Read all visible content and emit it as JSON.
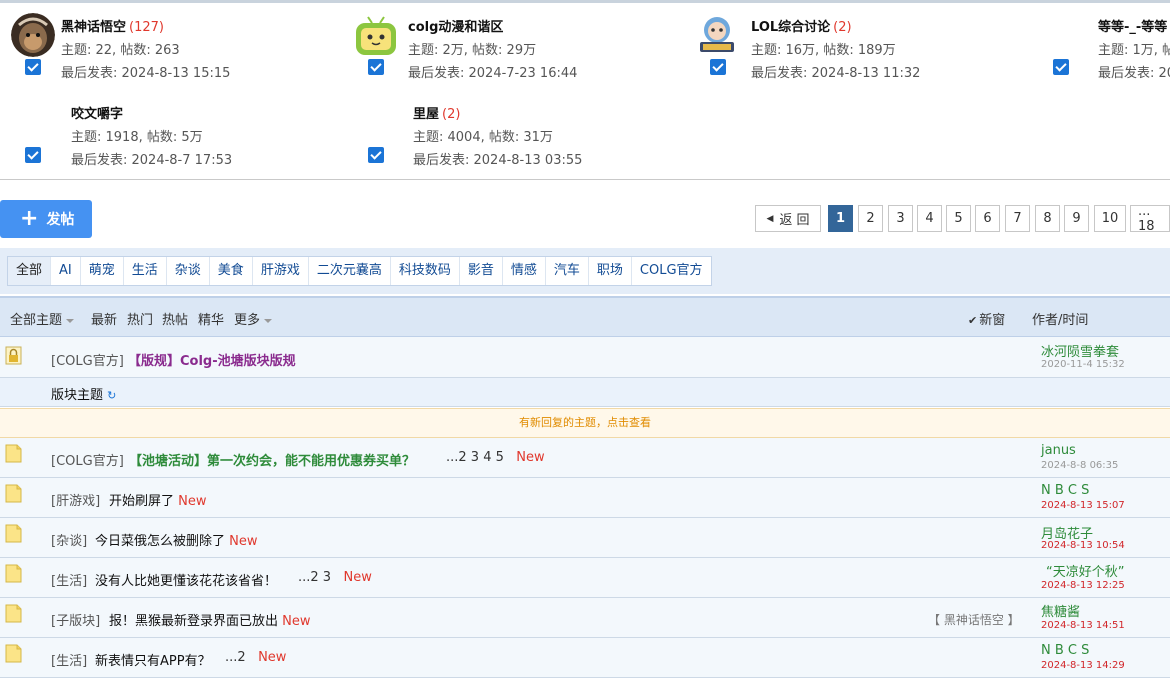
{
  "forums": [
    {
      "name": "黑神话悟空",
      "count": "(127)",
      "stat": "主题: 22, 帖数: 263",
      "last": "最后发表: 2024-8-13 15:15"
    },
    {
      "name": "colg动漫和谐区",
      "count": "",
      "stat": "主题: 2万, 帖数: 29万",
      "last": "最后发表: 2024-7-23 16:44"
    },
    {
      "name": "LOL综合讨论",
      "count": "(2)",
      "stat": "主题: 16万, 帖数: 189万",
      "last": "最后发表: 2024-8-13 11:32"
    },
    {
      "name": "等等-_-等等",
      "count": "",
      "stat": "主题: 1万, 帖数",
      "last": "最后发表: 20"
    },
    {
      "name": "咬文嚼字",
      "count": "",
      "stat": "主题: 1918, 帖数: 5万",
      "last": "最后发表: 2024-8-7 17:53"
    },
    {
      "name": "里屋",
      "count": "(2)",
      "stat": "主题: 4004, 帖数: 31万",
      "last": "最后发表: 2024-8-13 03:55"
    }
  ],
  "post_button": "发帖",
  "pager": {
    "back": "返 回",
    "pages": [
      "1",
      "2",
      "3",
      "4",
      "5",
      "6",
      "7",
      "8",
      "9",
      "10"
    ],
    "current": "1",
    "last": "... 18"
  },
  "categories": [
    "全部",
    "AI",
    "萌宠",
    "生活",
    "杂谈",
    "美食",
    "肝游戏",
    "二次元嚢高",
    "科技数码",
    "影音",
    "情感",
    "汽车",
    "职场",
    "COLG官方"
  ],
  "filters": {
    "all": "全部主题",
    "latest": "最新",
    "hot": "热门",
    "hotpost": "热帖",
    "digest": "精华",
    "more": "更多",
    "newwin": "新窗",
    "author_time": "作者/时间"
  },
  "sticky": {
    "sub": "[COLG官方]",
    "title": "【版规】Colg-池塘版块版规",
    "author": "冰河陨雪拳套",
    "time": "2020-11-4 15:32"
  },
  "section_label": "版块主题",
  "notice": "有新回复的主题，点击查看",
  "threads": [
    {
      "sub": "[COLG官方]",
      "title": "【池塘活动】第一次约会，能不能用优惠券买单？",
      "pages": "...2  3  4  5",
      "new": "New",
      "author": "janus",
      "time": "2024-8-8 06:35",
      "from": ""
    },
    {
      "sub": "[肝游戏]",
      "title": "开始刷屏了",
      "pages": "",
      "new": "New",
      "author": "N B C S",
      "time": "2024-8-13 15:07",
      "from": ""
    },
    {
      "sub": "[杂谈]",
      "title": "今日菜俄怎么被删除了",
      "pages": "",
      "new": "New",
      "author": "月岛花子",
      "time": "2024-8-13 10:54",
      "from": ""
    },
    {
      "sub": "[生活]",
      "title": "没有人比她更懂该花花该省省！",
      "pages": "...2  3",
      "new": "New",
      "author": "“天凉好个秋”",
      "time": "2024-8-13 12:25",
      "from": ""
    },
    {
      "sub": "[子版块]",
      "title": "报！黑猴最新登录界面已放出",
      "pages": "",
      "new": "New",
      "author": "焦糖酱",
      "time": "2024-8-13 14:51",
      "from": "【 黑神话悟空 】"
    },
    {
      "sub": "[生活]",
      "title": "新表情只有APP有？",
      "pages": "...2",
      "new": "New",
      "author": "N B C S",
      "time": "2024-8-13 14:29",
      "from": ""
    }
  ]
}
